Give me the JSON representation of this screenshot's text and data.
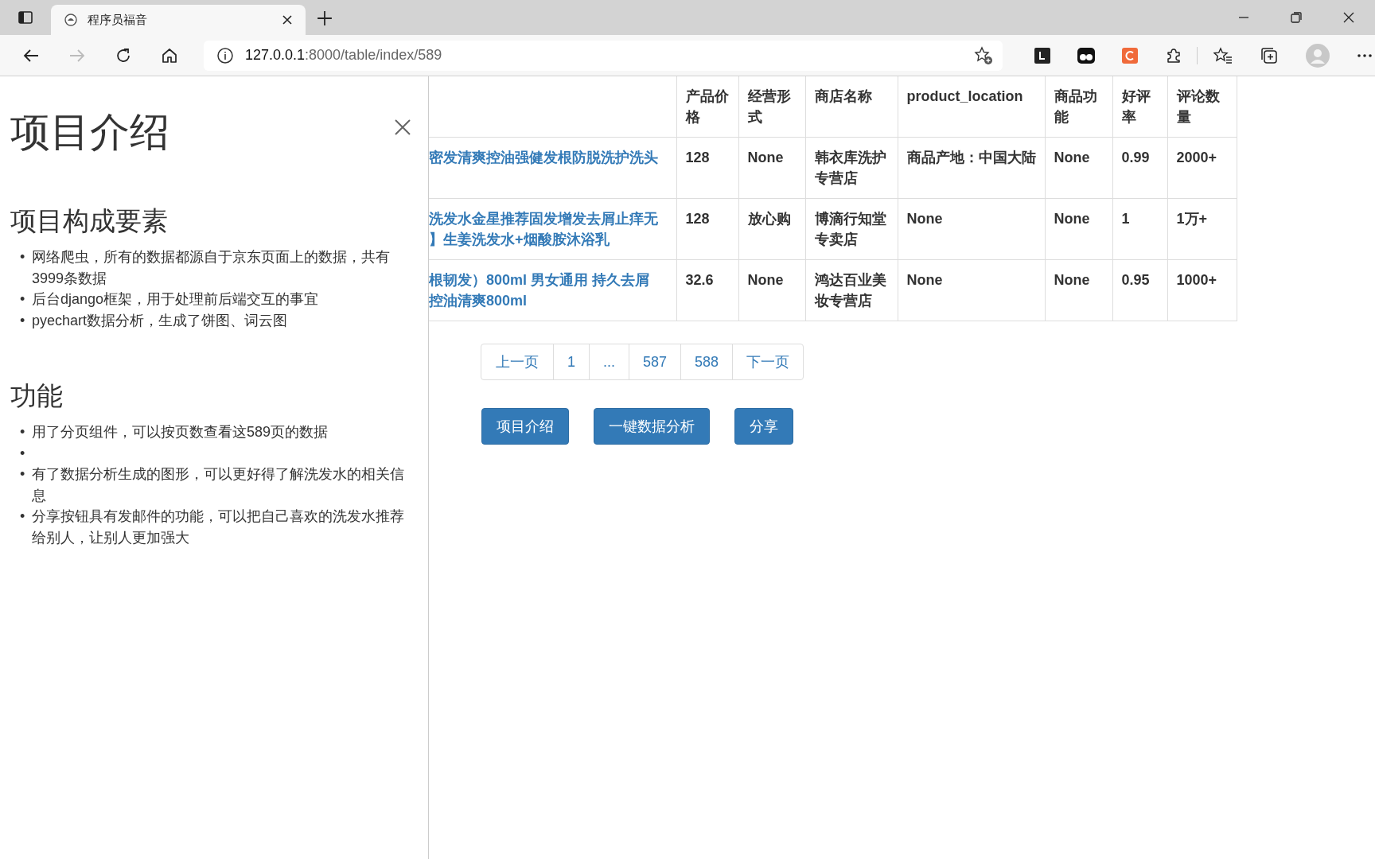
{
  "browser": {
    "tab_title": "程序员福音",
    "url": {
      "host": "127.0.0.1",
      "rest": ":8000/table/index/589"
    },
    "nav_buttons": [
      {
        "kind": "back",
        "disabled": false
      },
      {
        "kind": "forward",
        "disabled": true
      },
      {
        "kind": "reload",
        "disabled": false
      },
      {
        "kind": "home",
        "disabled": false
      }
    ]
  },
  "sidebar": {
    "title": "项目介绍",
    "sections": [
      {
        "heading": "项目构成要素",
        "items": [
          {
            "kind": "text",
            "marker": "•",
            "text": "网络爬虫，所有的数据都源自于京东页面上的数据，共有3999条数据"
          },
          {
            "kind": "text",
            "marker": "•",
            "text": "后台django框架，用于处理前后端交互的事宜"
          },
          {
            "kind": "text",
            "marker": "•",
            "text": "pyechart数据分析，生成了饼图、词云图"
          }
        ]
      },
      {
        "heading": "功能",
        "items": [
          {
            "kind": "text",
            "marker": "•",
            "text": "用了分页组件，可以按页数查看这589页的数据"
          },
          {
            "kind": "empty",
            "marker": "•"
          },
          {
            "kind": "text",
            "marker": "•",
            "text": "有了数据分析生成的图形，可以更好得了解洗发水的相关信息"
          },
          {
            "kind": "text",
            "marker": "•",
            "text": "分享按钮具有发邮件的功能，可以把自己喜欢的洗发水推荐给别人，让别人更加强大"
          }
        ]
      }
    ]
  },
  "table": {
    "columns": [
      "产品价格",
      "经营形式",
      "商店名称",
      "product_location",
      "商品功能",
      "好评率",
      "评论数量"
    ],
    "rows": [
      {
        "column_1": [
          "密发清爽控油强健发根防脱洗护洗头"
        ],
        "cells": [
          "128",
          "None",
          "韩衣库洗护专营店",
          "商品产地：中国大陆",
          "None",
          "0.99",
          "2000+"
        ]
      },
      {
        "column_1": [
          "洗发水金星推荐固发增发去屑止痒无",
          "】生姜洗发水+烟酸胺沐浴乳"
        ],
        "cells": [
          "128",
          "放心购",
          "博滴行知堂专卖店",
          "None",
          "None",
          "1",
          "1万+"
        ]
      },
      {
        "column_1": [
          "根韧发）800ml 男女通用 持久去屑",
          "控油清爽800ml"
        ],
        "cells": [
          "32.6",
          "None",
          "鸿达百业美妆专营店",
          "None",
          "None",
          "0.95",
          "1000+"
        ]
      }
    ]
  },
  "pagination": [
    "上一页",
    "1",
    "...",
    "587",
    "588",
    "下一页"
  ],
  "buttons": [
    "项目介绍",
    "一键数据分析",
    "分享"
  ]
}
